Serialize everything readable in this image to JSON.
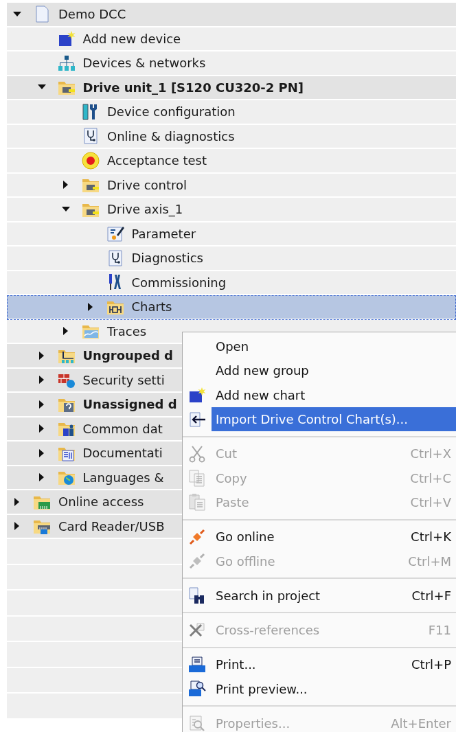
{
  "project_tree": [
    {
      "label": "Demo DCC",
      "kind": "project",
      "expanded": true,
      "selected": false,
      "shaded": true,
      "children": [
        {
          "label": "Add new device",
          "kind": "add-device",
          "selected": false,
          "shaded": false
        },
        {
          "label": "Devices & networks",
          "kind": "network",
          "selected": false,
          "shaded": false
        },
        {
          "label": "Drive unit_1 [S120 CU320-2 PN]",
          "kind": "drive-folder",
          "bold": true,
          "expanded": true,
          "selected": false,
          "shaded": true,
          "children": [
            {
              "label": "Device configuration",
              "kind": "config",
              "selected": false,
              "shaded": false
            },
            {
              "label": "Online & diagnostics",
              "kind": "diagnostics",
              "selected": false,
              "shaded": false
            },
            {
              "label": "Acceptance test",
              "kind": "acceptance",
              "selected": false,
              "shaded": false
            },
            {
              "label": "Drive control",
              "kind": "drive-folder",
              "expanded": false,
              "selected": false,
              "shaded": false
            },
            {
              "label": "Drive axis_1",
              "kind": "drive-folder",
              "expanded": true,
              "selected": false,
              "shaded": false,
              "children": [
                {
                  "label": "Parameter",
                  "kind": "parameter",
                  "selected": false,
                  "shaded": false
                },
                {
                  "label": "Diagnostics",
                  "kind": "diagnostics",
                  "selected": false,
                  "shaded": false
                },
                {
                  "label": "Commissioning",
                  "kind": "commissioning",
                  "selected": false,
                  "shaded": false
                },
                {
                  "label": "Charts",
                  "kind": "chart-folder",
                  "expanded": false,
                  "selected": true,
                  "shaded": false
                }
              ]
            },
            {
              "label": "Traces",
              "kind": "trace-folder",
              "expanded": false,
              "selected": false,
              "shaded": false
            }
          ]
        },
        {
          "label": "Ungrouped d",
          "kind": "group-folder",
          "bold": true,
          "expanded": false,
          "selected": false,
          "shaded": true
        },
        {
          "label": "Security setti",
          "kind": "security-folder",
          "expanded": false,
          "selected": false,
          "shaded": true
        },
        {
          "label": "Unassigned d",
          "kind": "unassigned-folder",
          "bold": true,
          "expanded": false,
          "selected": false,
          "shaded": true
        },
        {
          "label": "Common dat",
          "kind": "data-folder",
          "expanded": false,
          "selected": false,
          "shaded": true
        },
        {
          "label": "Documentati",
          "kind": "doc-folder",
          "expanded": false,
          "selected": false,
          "shaded": true
        },
        {
          "label": "Languages &",
          "kind": "language-folder",
          "expanded": false,
          "selected": false,
          "shaded": true
        }
      ]
    },
    {
      "label": "Online access",
      "kind": "online-folder",
      "expanded": false,
      "selected": false,
      "shaded": true
    },
    {
      "label": "Card Reader/USB",
      "kind": "card-folder",
      "expanded": false,
      "selected": false,
      "shaded": true
    }
  ],
  "context_menu": [
    {
      "kind": "item",
      "label": "Open",
      "disabled": false,
      "selected": false
    },
    {
      "kind": "item",
      "label": "Add new group",
      "disabled": false,
      "selected": false
    },
    {
      "kind": "item",
      "label": "Add new chart",
      "disabled": false,
      "selected": false
    },
    {
      "kind": "item",
      "label": "Import Drive Control Chart(s)...",
      "disabled": false,
      "selected": true
    },
    {
      "kind": "separator"
    },
    {
      "kind": "item",
      "label": "Cut",
      "shortcut": "Ctrl+X",
      "disabled": true,
      "selected": false
    },
    {
      "kind": "item",
      "label": "Copy",
      "shortcut": "Ctrl+C",
      "disabled": true,
      "selected": false
    },
    {
      "kind": "item",
      "label": "Paste",
      "shortcut": "Ctrl+V",
      "disabled": true,
      "selected": false
    },
    {
      "kind": "separator"
    },
    {
      "kind": "item",
      "label": "Go online",
      "shortcut": "Ctrl+K",
      "disabled": false,
      "selected": false
    },
    {
      "kind": "item",
      "label": "Go offline",
      "shortcut": "Ctrl+M",
      "disabled": true,
      "selected": false
    },
    {
      "kind": "separator"
    },
    {
      "kind": "item",
      "label": "Search in project",
      "shortcut": "Ctrl+F",
      "disabled": false,
      "selected": false
    },
    {
      "kind": "separator"
    },
    {
      "kind": "item",
      "label": "Cross-references",
      "shortcut": "F11",
      "disabled": true,
      "selected": false
    },
    {
      "kind": "separator"
    },
    {
      "kind": "item",
      "label": "Print...",
      "shortcut": "Ctrl+P",
      "disabled": false,
      "selected": false
    },
    {
      "kind": "item",
      "label": "Print preview...",
      "disabled": false,
      "selected": false
    },
    {
      "kind": "separator"
    },
    {
      "kind": "item",
      "label": "Properties...",
      "shortcut": "Alt+Enter",
      "disabled": true,
      "selected": false
    }
  ]
}
